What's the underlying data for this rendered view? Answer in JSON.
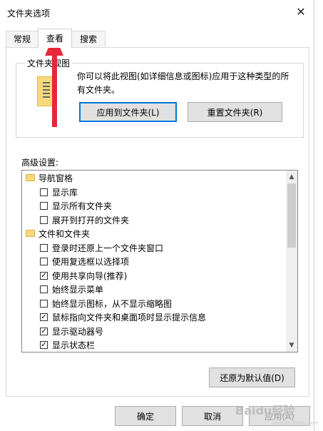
{
  "dialog": {
    "title": "文件夹选项"
  },
  "tabs": [
    {
      "label": "常规"
    },
    {
      "label": "查看"
    },
    {
      "label": "搜索"
    }
  ],
  "folder_views": {
    "title": "文件夹视图",
    "description": "你可以将此视图(如详细信息或图标)应用于这种类型的所有文件夹。",
    "apply_button": "应用到文件夹(L)",
    "reset_button": "重置文件夹(R)"
  },
  "advanced": {
    "label": "高级设置:",
    "items": [
      {
        "type": "folder",
        "label": "导航窗格"
      },
      {
        "type": "check",
        "label": "显示库",
        "checked": false
      },
      {
        "type": "check",
        "label": "显示所有文件夹",
        "checked": false
      },
      {
        "type": "check",
        "label": "展开到打开的文件夹",
        "checked": false
      },
      {
        "type": "folder",
        "label": "文件和文件夹"
      },
      {
        "type": "check",
        "label": "登录时还原上一个文件夹窗口",
        "checked": false
      },
      {
        "type": "check",
        "label": "使用复选框以选择项",
        "checked": false
      },
      {
        "type": "check",
        "label": "使用共享向导(推荐)",
        "checked": true
      },
      {
        "type": "check",
        "label": "始终显示菜单",
        "checked": false
      },
      {
        "type": "check",
        "label": "始终显示图标，从不显示缩略图",
        "checked": false
      },
      {
        "type": "check",
        "label": "鼠标指向文件夹和桌面项时显示提示信息",
        "checked": true
      },
      {
        "type": "check",
        "label": "显示驱动器号",
        "checked": true
      },
      {
        "type": "check",
        "label": "显示状态栏",
        "checked": true
      }
    ]
  },
  "restore_defaults_button": "还原为默认值(D)",
  "footer": {
    "ok": "确定",
    "cancel": "取消",
    "apply": "应用(A)"
  },
  "watermark": {
    "text": "Baidu经验",
    "sub": "jingyan.baidu.com"
  },
  "colors": {
    "accent": "#0078d7",
    "annotation_arrow": "#e8263a",
    "folder": "#f7d97b"
  }
}
